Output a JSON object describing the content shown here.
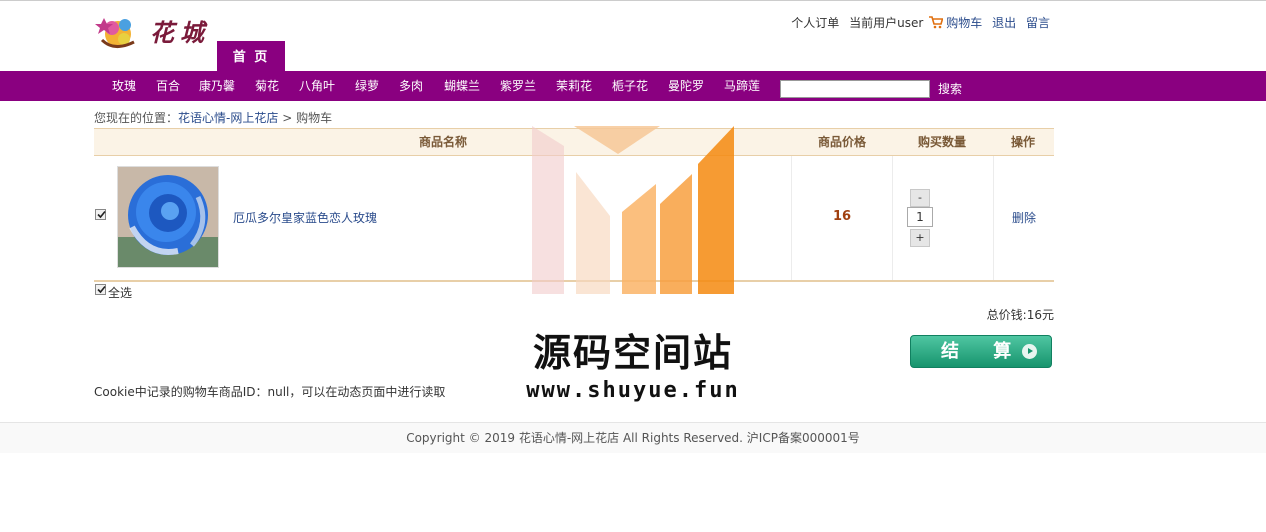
{
  "header": {
    "nav_home": "首 页",
    "links": {
      "orders": "个人订单",
      "current_user": "当前用户user",
      "cart": "购物车",
      "logout": "退出",
      "message": "留言"
    }
  },
  "categories": [
    "玫瑰",
    "百合",
    "康乃馨",
    "菊花",
    "八角叶",
    "绿萝",
    "多肉",
    "蝴蝶兰",
    "紫罗兰",
    "茉莉花",
    "栀子花",
    "曼陀罗",
    "马蹄莲"
  ],
  "search": {
    "value": "",
    "button": "搜索"
  },
  "breadcrumb": {
    "prefix": "您现在的位置：",
    "home": "花语心情-网上花店",
    "sep": ">",
    "current": "购物车"
  },
  "table": {
    "headers": {
      "name": "商品名称",
      "price": "商品价格",
      "qty": "购买数量",
      "action": "操作"
    },
    "rows": [
      {
        "checked": true,
        "name": "厄瓜多尔皇家蓝色恋人玫瑰",
        "price": "16",
        "qty": "1",
        "minus": "-",
        "plus": "+",
        "delete": "删除"
      }
    ]
  },
  "select_all": {
    "checked": true,
    "label": "全选"
  },
  "total": "总价钱:16元",
  "checkout_label": "结 算",
  "cookie_note": "Cookie中记录的购物车商品ID：null，可以在动态页面中进行读取",
  "footer": "Copyright © 2019 花语心情-网上花店 All Rights Reserved. 沪ICP备案000001号",
  "watermark": {
    "title": "源码空间站",
    "url": "www.shuyue.fun"
  },
  "colors": {
    "brand_purple": "#8a0080",
    "link_blue": "#2b4c8c",
    "price": "#a04010",
    "checkout_green": "#17946d"
  }
}
